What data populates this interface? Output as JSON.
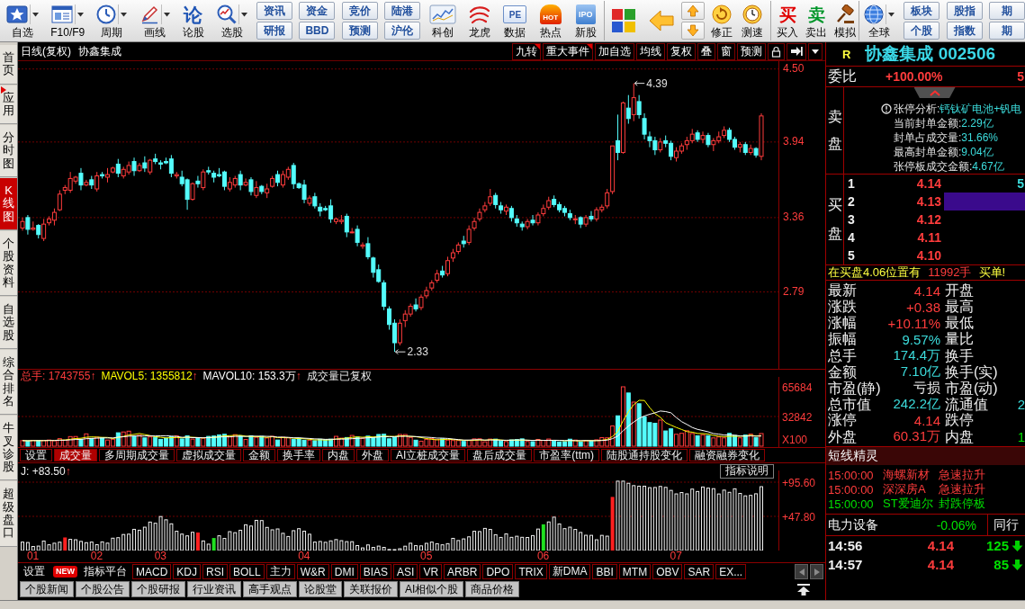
{
  "toolbar": {
    "groups": [
      [
        {
          "kind": "tool",
          "label": "自选",
          "dropdown": true
        },
        {
          "kind": "tool",
          "label": "F10/F9",
          "dropdown": true
        },
        {
          "kind": "tool",
          "label": "周期",
          "dropdown": true
        },
        {
          "kind": "tool",
          "label": "画线",
          "dropdown": true
        },
        {
          "kind": "tool",
          "label": "论股",
          "glyph": "论",
          "dropdown": false
        },
        {
          "kind": "tool",
          "label": "选股",
          "dropdown": true
        },
        {
          "kind": "pair",
          "top": "资讯",
          "bottom": "研报"
        },
        {
          "kind": "pair",
          "top": "资金",
          "bottom": "BBD"
        },
        {
          "kind": "pair",
          "top": "竞价",
          "bottom": "预测"
        },
        {
          "kind": "pair",
          "top": "陆港",
          "bottom": "沪伦"
        },
        {
          "kind": "tool",
          "label": "科创",
          "dropdown": false
        },
        {
          "kind": "tool",
          "label": "龙虎",
          "dropdown": false
        },
        {
          "kind": "tool",
          "label": "数据",
          "glyph": "PE",
          "dropdown": false
        },
        {
          "kind": "tool",
          "label": "热点",
          "glyph": "HOT",
          "dropdown": false
        },
        {
          "kind": "tool",
          "label": "新股",
          "glyph": "IPO",
          "dropdown": false
        }
      ],
      [
        {
          "kind": "icon"
        },
        {
          "kind": "icon"
        },
        {
          "kind": "arrows"
        },
        {
          "kind": "tool",
          "label": "修正",
          "dropdown": false
        },
        {
          "kind": "tool",
          "label": "测速",
          "dropdown": false
        }
      ],
      [
        {
          "kind": "tool",
          "label": "买入",
          "glyph": "买",
          "dropdown": false
        },
        {
          "kind": "tool",
          "label": "卖出",
          "glyph": "卖",
          "dropdown": false
        },
        {
          "kind": "tool",
          "label": "模拟",
          "dropdown": false
        }
      ],
      [
        {
          "kind": "tool",
          "label": "全球",
          "dropdown": true
        },
        {
          "kind": "pair",
          "top": "板块",
          "bottom": "个股"
        },
        {
          "kind": "pair",
          "top": "股指",
          "bottom": "指数"
        },
        {
          "kind": "pair",
          "top": "期",
          "bottom": "期"
        }
      ]
    ]
  },
  "side_tabs": [
    {
      "label": "首页",
      "selected": false,
      "flag": false
    },
    {
      "label": "应用",
      "selected": false,
      "flag": true
    },
    {
      "label": "分时图",
      "selected": false,
      "flag": false
    },
    {
      "label": "K线图",
      "selected": true,
      "flag": false
    },
    {
      "label": "个股资料",
      "selected": false,
      "flag": false
    },
    {
      "label": "自选股",
      "selected": false,
      "flag": false
    },
    {
      "label": "综合排名",
      "selected": false,
      "flag": false
    },
    {
      "label": "牛叉诊股",
      "selected": false,
      "flag": false
    },
    {
      "label": "超级盘口",
      "selected": false,
      "flag": false
    }
  ],
  "chart": {
    "period": "日线(复权)",
    "name": "协鑫集成",
    "buttons": [
      {
        "label": "九转",
        "flag": true
      },
      {
        "label": "重大事件",
        "flag": true
      },
      {
        "label": "加自选",
        "flag": false
      },
      {
        "label": "均线",
        "flag": false
      },
      {
        "label": "复权",
        "flag": false
      },
      {
        "label": "叠",
        "flag": false
      },
      {
        "label": "窗",
        "flag": false
      },
      {
        "label": "预测",
        "flag": false
      }
    ],
    "high_label": "4.39",
    "low_label": "2.33",
    "chart_data": {
      "type": "candlestick",
      "categories": [
        null,
        null,
        null,
        null,
        null,
        null,
        null,
        null,
        null,
        null,
        null,
        null,
        null,
        null,
        null,
        null,
        null,
        null,
        null,
        null,
        null,
        null,
        null,
        null,
        null,
        null,
        null,
        null,
        null,
        null,
        null,
        null,
        null,
        null,
        null,
        null,
        null,
        null,
        null,
        null,
        null,
        null,
        null,
        null,
        null,
        null,
        null,
        null,
        null,
        null,
        null,
        null,
        null,
        null,
        null,
        null,
        null,
        null,
        null,
        null,
        null,
        null,
        null,
        null,
        null,
        null,
        null,
        null,
        null,
        null,
        null,
        null,
        null,
        null,
        null,
        null,
        null,
        null,
        null,
        null,
        null,
        null,
        null,
        null,
        null,
        null,
        null,
        null,
        null,
        null,
        null,
        null,
        null,
        null,
        null,
        null,
        null,
        null,
        null,
        null,
        null,
        null,
        null,
        null,
        null,
        null,
        null,
        null,
        null,
        null,
        null,
        null,
        null,
        null,
        null,
        null,
        null,
        null,
        null,
        null,
        null,
        null,
        null,
        null,
        null,
        null,
        null,
        null,
        null,
        null,
        null,
        null,
        null,
        null,
        null,
        null,
        null,
        null,
        null,
        null
      ],
      "ohlc": [
        [
          3.28,
          3.36,
          3.26,
          3.33
        ],
        [
          3.36,
          3.38,
          3.23,
          3.27
        ],
        [
          3.27,
          3.33,
          3.26,
          3.28
        ],
        [
          3.3,
          3.31,
          3.2,
          3.23
        ],
        [
          3.2,
          3.35,
          3.18,
          3.31
        ],
        [
          3.32,
          3.37,
          3.3,
          3.35
        ],
        [
          3.34,
          3.43,
          3.3,
          3.4
        ],
        [
          3.42,
          3.57,
          3.41,
          3.54
        ],
        [
          3.57,
          3.61,
          3.54,
          3.59
        ],
        [
          3.57,
          3.71,
          3.55,
          3.66
        ],
        [
          3.64,
          3.68,
          3.62,
          3.67
        ],
        [
          3.7,
          3.74,
          3.57,
          3.61
        ],
        [
          3.61,
          3.65,
          3.6,
          3.63
        ],
        [
          3.65,
          3.68,
          3.58,
          3.61
        ],
        [
          3.58,
          3.71,
          3.56,
          3.68
        ],
        [
          3.69,
          3.71,
          3.66,
          3.68
        ],
        [
          3.67,
          3.74,
          3.63,
          3.69
        ],
        [
          3.71,
          3.75,
          3.7,
          3.74
        ],
        [
          3.77,
          3.81,
          3.67,
          3.7
        ],
        [
          3.68,
          3.75,
          3.66,
          3.73
        ],
        [
          3.71,
          3.79,
          3.69,
          3.76
        ],
        [
          3.79,
          3.82,
          3.68,
          3.72
        ],
        [
          3.72,
          3.78,
          3.71,
          3.76
        ],
        [
          3.78,
          3.83,
          3.71,
          3.74
        ],
        [
          3.71,
          3.81,
          3.69,
          3.8
        ],
        [
          3.81,
          3.85,
          3.77,
          3.79
        ],
        [
          3.78,
          3.8,
          3.73,
          3.77
        ],
        [
          3.79,
          3.82,
          3.77,
          3.78
        ],
        [
          3.81,
          3.84,
          3.67,
          3.7
        ],
        [
          3.68,
          3.71,
          3.66,
          3.69
        ],
        [
          3.67,
          3.72,
          3.6,
          3.62
        ],
        [
          3.65,
          3.66,
          3.42,
          3.5
        ],
        [
          3.5,
          3.63,
          3.49,
          3.62
        ],
        [
          3.64,
          3.68,
          3.59,
          3.62
        ],
        [
          3.59,
          3.73,
          3.57,
          3.71
        ],
        [
          3.72,
          3.75,
          3.69,
          3.71
        ],
        [
          3.7,
          3.72,
          3.63,
          3.67
        ],
        [
          3.69,
          3.74,
          3.67,
          3.68
        ],
        [
          3.71,
          3.72,
          3.57,
          3.6
        ],
        [
          3.58,
          3.67,
          3.56,
          3.63
        ],
        [
          3.61,
          3.68,
          3.59,
          3.66
        ],
        [
          3.69,
          3.72,
          3.57,
          3.61
        ],
        [
          3.61,
          3.66,
          3.6,
          3.63
        ],
        [
          3.65,
          3.67,
          3.53,
          3.56
        ],
        [
          3.53,
          3.64,
          3.51,
          3.59
        ],
        [
          3.6,
          3.61,
          3.54,
          3.56
        ],
        [
          3.55,
          3.62,
          3.51,
          3.58
        ],
        [
          3.6,
          3.68,
          3.59,
          3.66
        ],
        [
          3.69,
          3.72,
          3.6,
          3.63
        ],
        [
          3.61,
          3.72,
          3.59,
          3.69
        ],
        [
          3.67,
          3.75,
          3.65,
          3.73
        ],
        [
          3.76,
          3.78,
          3.58,
          3.62
        ],
        [
          3.62,
          3.63,
          3.58,
          3.59
        ],
        [
          3.61,
          3.65,
          3.47,
          3.5
        ],
        [
          3.47,
          3.53,
          3.45,
          3.51
        ],
        [
          3.52,
          3.55,
          3.43,
          3.45
        ],
        [
          3.44,
          3.47,
          3.37,
          3.41
        ],
        [
          3.43,
          3.45,
          3.41,
          3.42
        ],
        [
          3.45,
          3.5,
          3.32,
          3.35
        ],
        [
          3.33,
          3.36,
          3.31,
          3.35
        ],
        [
          3.33,
          3.38,
          3.31,
          3.34
        ],
        [
          3.37,
          3.39,
          3.21,
          3.25
        ],
        [
          3.25,
          3.28,
          3.24,
          3.25
        ],
        [
          3.27,
          3.3,
          3.14,
          3.17
        ],
        [
          3.14,
          3.17,
          3.12,
          3.15
        ],
        [
          3.16,
          3.21,
          3.04,
          3.06
        ],
        [
          3.05,
          3.06,
          2.9,
          2.94
        ],
        [
          2.96,
          3.0,
          2.86,
          2.87
        ],
        [
          2.86,
          2.88,
          2.65,
          2.68
        ],
        [
          2.66,
          2.68,
          2.5,
          2.54
        ],
        [
          2.55,
          2.58,
          2.33,
          2.4
        ],
        [
          2.4,
          2.58,
          2.38,
          2.55
        ],
        [
          2.57,
          2.65,
          2.52,
          2.62
        ],
        [
          2.62,
          2.7,
          2.6,
          2.68
        ],
        [
          2.69,
          2.74,
          2.64,
          2.66
        ],
        [
          2.67,
          2.77,
          2.65,
          2.75
        ],
        [
          2.76,
          2.83,
          2.74,
          2.8
        ],
        [
          2.82,
          2.88,
          2.8,
          2.86
        ],
        [
          2.88,
          2.96,
          2.86,
          2.93
        ],
        [
          2.95,
          2.99,
          2.9,
          2.92
        ],
        [
          2.93,
          3.06,
          2.91,
          3.03
        ],
        [
          3.05,
          3.12,
          3.02,
          3.09
        ],
        [
          3.1,
          3.17,
          3.08,
          3.15
        ],
        [
          3.18,
          3.22,
          3.13,
          3.16
        ],
        [
          3.17,
          3.3,
          3.15,
          3.27
        ],
        [
          3.28,
          3.36,
          3.26,
          3.33
        ],
        [
          3.35,
          3.43,
          3.33,
          3.4
        ],
        [
          3.42,
          3.48,
          3.4,
          3.45
        ],
        [
          3.47,
          3.58,
          3.45,
          3.52
        ],
        [
          3.53,
          3.55,
          3.43,
          3.46
        ],
        [
          3.45,
          3.48,
          3.39,
          3.42
        ],
        [
          3.41,
          3.46,
          3.38,
          3.44
        ],
        [
          3.43,
          3.45,
          3.33,
          3.36
        ],
        [
          3.35,
          3.38,
          3.29,
          3.32
        ],
        [
          3.31,
          3.33,
          3.26,
          3.29
        ],
        [
          3.29,
          3.35,
          3.27,
          3.33
        ],
        [
          3.34,
          3.38,
          3.3,
          3.32
        ],
        [
          3.32,
          3.4,
          3.3,
          3.38
        ],
        [
          3.39,
          3.46,
          3.37,
          3.43
        ],
        [
          3.44,
          3.52,
          3.42,
          3.49
        ],
        [
          3.5,
          3.53,
          3.44,
          3.46
        ],
        [
          3.46,
          3.48,
          3.4,
          3.42
        ],
        [
          3.43,
          3.45,
          3.37,
          3.4
        ],
        [
          3.39,
          3.42,
          3.34,
          3.36
        ],
        [
          3.35,
          3.38,
          3.31,
          3.35
        ],
        [
          3.36,
          3.37,
          3.28,
          3.31
        ],
        [
          3.31,
          3.38,
          3.29,
          3.36
        ],
        [
          3.37,
          3.41,
          3.33,
          3.35
        ],
        [
          3.35,
          3.44,
          3.33,
          3.42
        ],
        [
          3.42,
          3.46,
          3.4,
          3.44
        ],
        [
          3.45,
          3.58,
          3.43,
          3.55
        ],
        [
          3.56,
          3.91,
          3.54,
          3.91
        ],
        [
          3.95,
          4.15,
          3.8,
          3.86
        ],
        [
          3.86,
          4.25,
          3.85,
          4.24
        ],
        [
          4.2,
          4.3,
          4.08,
          4.12
        ],
        [
          4.15,
          4.39,
          4.1,
          4.28
        ],
        [
          4.25,
          4.3,
          4.12,
          4.15
        ],
        [
          4.12,
          4.16,
          3.96,
          4.0
        ],
        [
          3.98,
          4.02,
          3.9,
          3.95
        ],
        [
          3.95,
          3.98,
          3.84,
          3.88
        ],
        [
          3.88,
          3.97,
          3.86,
          3.94
        ],
        [
          3.95,
          3.99,
          3.9,
          3.93
        ],
        [
          3.93,
          3.95,
          3.8,
          3.83
        ],
        [
          3.82,
          3.9,
          3.79,
          3.87
        ],
        [
          3.87,
          3.93,
          3.85,
          3.91
        ],
        [
          3.92,
          3.98,
          3.88,
          3.95
        ],
        [
          3.95,
          4.04,
          3.93,
          4.0
        ],
        [
          4.01,
          4.03,
          3.94,
          3.96
        ],
        [
          3.96,
          4.02,
          3.93,
          3.99
        ],
        [
          3.99,
          4.01,
          3.9,
          3.92
        ],
        [
          3.92,
          3.97,
          3.87,
          3.95
        ],
        [
          3.95,
          4.02,
          3.93,
          3.98
        ],
        [
          3.99,
          4.06,
          3.97,
          4.03
        ],
        [
          4.03,
          4.05,
          3.94,
          3.96
        ],
        [
          3.96,
          3.98,
          3.88,
          3.9
        ],
        [
          3.9,
          3.94,
          3.86,
          3.92
        ],
        [
          3.92,
          3.94,
          3.84,
          3.86
        ],
        [
          3.86,
          3.92,
          3.84,
          3.89
        ],
        [
          3.89,
          3.9,
          3.82,
          3.84
        ],
        [
          3.83,
          4.16,
          3.8,
          4.14
        ]
      ],
      "ylim": [
        2.2,
        4.56
      ],
      "grid": true,
      "yticks": [
        {
          "value": 4.5,
          "label": "4.50"
        },
        {
          "value": 3.94,
          "label": "3.94"
        },
        {
          "value": 3.36,
          "label": "3.36"
        },
        {
          "value": 2.79,
          "label": "2.79"
        }
      ]
    }
  },
  "volume": {
    "legend": [
      {
        "label": "总手: 1743755",
        "arrow": "↑",
        "color": "#ff3c3c"
      },
      {
        "label": "MAVOL5: 1355812",
        "arrow": "↑",
        "color": "#ffff00"
      },
      {
        "label": "MAVOL10: 153.3万",
        "arrow": "↑",
        "color": "#ffffff"
      }
    ],
    "note": "成交量已复权",
    "ticks": [
      "65684",
      "32842"
    ],
    "unit": "X100",
    "tabs": [
      {
        "label": "设置",
        "selected": false
      },
      {
        "label": "成交量",
        "selected": true
      },
      {
        "label": "多周期成交量",
        "selected": false
      },
      {
        "label": "虚拟成交量",
        "selected": false
      },
      {
        "label": "金额",
        "selected": false
      },
      {
        "label": "换手率",
        "selected": false
      },
      {
        "label": "内盘",
        "selected": false
      },
      {
        "label": "外盘",
        "selected": false
      },
      {
        "label": "AI立桩成交量",
        "selected": false
      },
      {
        "label": "盘后成交量",
        "selected": false
      },
      {
        "label": "市盈率(ttm)",
        "selected": false
      },
      {
        "label": "陆股通持股变化",
        "selected": false
      },
      {
        "label": "融资融券变化",
        "selected": false
      }
    ]
  },
  "indicator": {
    "legend": "J: +83.50",
    "arrow": "↑",
    "help": "指标说明",
    "ticks": [
      "+95.60",
      "+47.80"
    ]
  },
  "dates": [
    "01",
    "02",
    "03",
    "04",
    "05",
    "06",
    "07"
  ],
  "indicator_tabs": [
    {
      "label": "设置",
      "kind": "link"
    },
    {
      "label": "指标平台",
      "kind": "link",
      "badge": "NEW"
    },
    {
      "label": "MACD",
      "kind": "tab"
    },
    {
      "label": "KDJ",
      "kind": "tab"
    },
    {
      "label": "RSI",
      "kind": "tab"
    },
    {
      "label": "BOLL",
      "kind": "tab"
    },
    {
      "label": "主力",
      "kind": "tab"
    },
    {
      "label": "W&R",
      "kind": "tab"
    },
    {
      "label": "DMI",
      "kind": "tab"
    },
    {
      "label": "BIAS",
      "kind": "tab"
    },
    {
      "label": "ASI",
      "kind": "tab"
    },
    {
      "label": "VR",
      "kind": "tab"
    },
    {
      "label": "ARBR",
      "kind": "tab"
    },
    {
      "label": "DPO",
      "kind": "tab"
    },
    {
      "label": "TRIX",
      "kind": "tab"
    },
    {
      "label": "新DMA",
      "kind": "tab"
    },
    {
      "label": "BBI",
      "kind": "tab"
    },
    {
      "label": "MTM",
      "kind": "tab"
    },
    {
      "label": "OBV",
      "kind": "tab"
    },
    {
      "label": "SAR",
      "kind": "tab"
    },
    {
      "label": "EX...",
      "kind": "tab"
    }
  ],
  "news_tabs": [
    "个股新闻",
    "个股公告",
    "个股研报",
    "行业资讯",
    "高手观点",
    "论股堂",
    "关联报价",
    "AI相似个股",
    "商品价格"
  ],
  "quote": {
    "flag": "R",
    "title": "协鑫集成 002506",
    "ratio": {
      "label": "委比",
      "value": "+100.00%",
      "value_2": "5"
    },
    "sell_label": "卖盘",
    "analysis": [
      {
        "label": "张停分析:",
        "value": "钙钛矿电池+钒电"
      },
      {
        "label": "当前封单金额:",
        "value": "2.29亿"
      },
      {
        "label": "封单占成交量:",
        "value": "31.66%"
      },
      {
        "label": "最高封单金额:",
        "value": "9.04亿"
      },
      {
        "label": "张停板成交金额:",
        "value": "4.67亿"
      }
    ],
    "buy_label": "买盘",
    "bids": [
      {
        "rank": "1",
        "price": "4.14",
        "volume": "5",
        "highlighted": false
      },
      {
        "rank": "2",
        "price": "4.13",
        "highlighted": true
      },
      {
        "rank": "3",
        "price": "4.12",
        "highlighted": false
      },
      {
        "rank": "4",
        "price": "4.11",
        "highlighted": false
      },
      {
        "rank": "5",
        "price": "4.10",
        "highlighted": false
      }
    ],
    "notice": {
      "text": "在买盘4.06位置有",
      "amount": "11992手",
      "suffix": "买单!"
    },
    "stats": [
      [
        {
          "label": "最新",
          "value": "4.14",
          "color": "#ff3c3c"
        },
        {
          "label": "开盘"
        }
      ],
      [
        {
          "label": "涨跌",
          "value": "+0.38",
          "color": "#ff3c3c"
        },
        {
          "label": "最高"
        }
      ],
      [
        {
          "label": "涨幅",
          "value": "+10.11%",
          "color": "#ff3c3c"
        },
        {
          "label": "最低"
        }
      ],
      [
        {
          "label": "振幅",
          "value": "9.57%",
          "color": "#3cdcdc"
        },
        {
          "label": "量比"
        }
      ],
      [
        {
          "label": "总手",
          "value": "174.4万",
          "color": "#3cdcdc"
        },
        {
          "label": "换手"
        }
      ],
      [
        {
          "label": "金额",
          "value": "7.10亿",
          "color": "#3cdcdc"
        },
        {
          "label": "换手(实)"
        }
      ],
      [
        {
          "label": "市盈(静)",
          "value": "亏损",
          "color": "#e8e8e8"
        },
        {
          "label": "市盈(动)"
        }
      ],
      [
        {
          "label": "总市值",
          "value": "242.2亿",
          "color": "#3cdcdc"
        },
        {
          "label": "流通值",
          "value": "2",
          "color": "#3cdcdc"
        }
      ],
      [
        {
          "label": "涨停",
          "value": "4.14",
          "color": "#ff3c3c"
        },
        {
          "label": "跌停"
        }
      ],
      [
        {
          "label": "外盘",
          "value": "60.31万",
          "color": "#ff3c3c"
        },
        {
          "label": "内盘",
          "value": "1",
          "color": "#00e000"
        }
      ]
    ]
  },
  "shortline": {
    "title": "短线精灵",
    "items": [
      {
        "time": "15:00:00",
        "stock": "海螺新材",
        "event": "急速拉升",
        "color": "#ff3c3c"
      },
      {
        "time": "15:00:00",
        "stock": "深深房A",
        "event": "急速拉升",
        "color": "#ff3c3c"
      },
      {
        "time": "15:00:00",
        "stock": "ST爱迪尔",
        "event": "封跌停板",
        "color": "#00e000"
      }
    ]
  },
  "industry": {
    "name": "电力设备",
    "change": "-0.06%",
    "peer": "同行"
  },
  "trades": [
    {
      "time": "14:56",
      "price": "4.14",
      "volume": "125",
      "kind": "down"
    },
    {
      "time": "14:57",
      "price": "4.14",
      "volume": "85",
      "kind": "down"
    }
  ]
}
